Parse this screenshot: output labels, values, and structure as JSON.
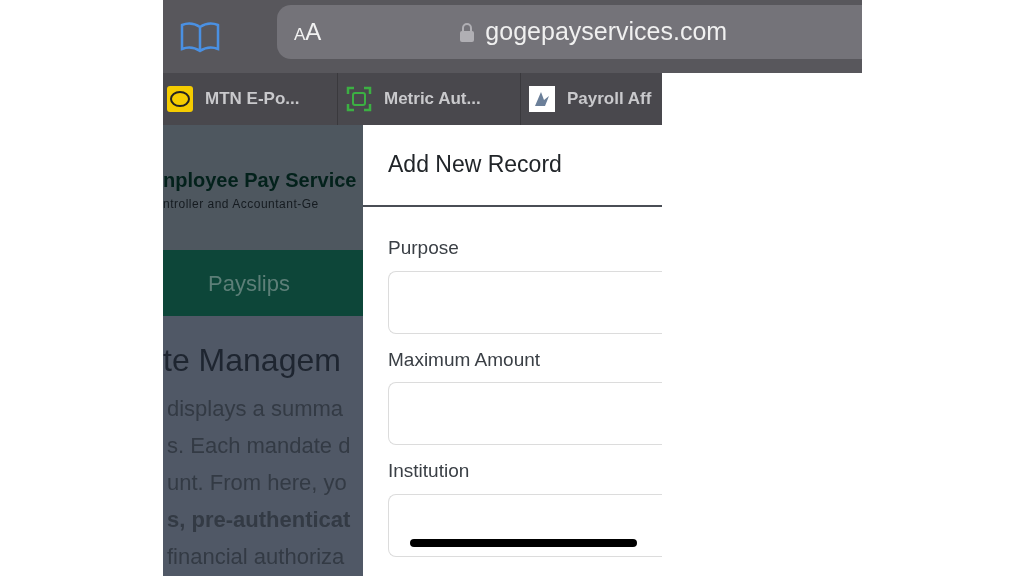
{
  "browser": {
    "text_size_button": "AA",
    "url": "gogepayservices.com",
    "favorites": [
      {
        "kind": "yellow-badge",
        "label": "MTN E-Po..."
      },
      {
        "kind": "scan-frame",
        "label": "Metric Aut..."
      },
      {
        "kind": "logo-tile",
        "label": "Payroll Aff"
      }
    ]
  },
  "page": {
    "site_title": "nployee Pay Service",
    "site_subtitle": "ntroller and Accountant-Ge",
    "nav_item": "Payslips",
    "heading": "te Managem",
    "paragraph_lines": [
      {
        "text": "displays a summa",
        "bold": false
      },
      {
        "text": "s. Each mandate d",
        "bold": false
      },
      {
        "text": "unt. From here, yo",
        "bold": false
      },
      {
        "text": "s, pre-authenticat",
        "bold": true
      },
      {
        "text": "financial authoriza",
        "bold": false
      }
    ]
  },
  "modal": {
    "title": "Add New Record",
    "fields": [
      {
        "label": "Purpose"
      },
      {
        "label": "Maximum Amount"
      },
      {
        "label": "Institution"
      }
    ]
  }
}
